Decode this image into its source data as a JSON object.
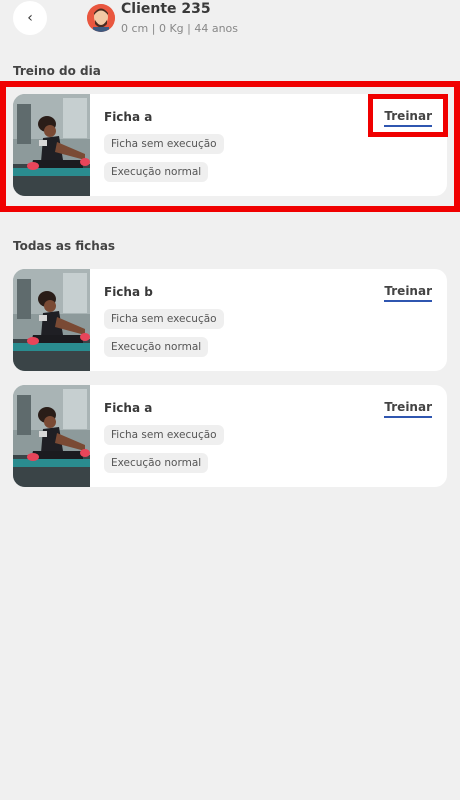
{
  "header": {
    "back_icon": "chevron-left-icon",
    "client_name": "Cliente 235",
    "client_meta": "0 cm | 0 Kg | 44 anos"
  },
  "today": {
    "section_title": "Treino do dia",
    "card": {
      "title": "Ficha a",
      "tag1": "Ficha sem execução",
      "tag2": "Execução normal",
      "action": "Treinar"
    }
  },
  "all": {
    "section_title": "Todas as fichas",
    "cards": [
      {
        "title": "Ficha b",
        "tag1": "Ficha sem execução",
        "tag2": "Execução normal",
        "action": "Treinar"
      },
      {
        "title": "Ficha a",
        "tag1": "Ficha sem execução",
        "tag2": "Execução normal",
        "action": "Treinar"
      }
    ]
  },
  "colors": {
    "background": "#f0f0f0",
    "card": "#ffffff",
    "link_underline": "#2f56b0",
    "highlight": "#f00000"
  }
}
